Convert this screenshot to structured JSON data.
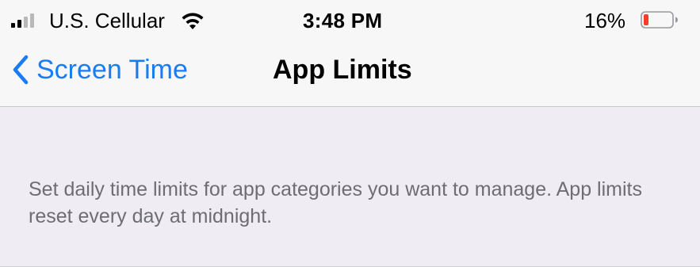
{
  "status_bar": {
    "carrier": "U.S. Cellular",
    "time": "3:48 PM",
    "battery_percent": "16%",
    "battery_level": 0.16,
    "battery_color": "#ff3b30",
    "signal_bars": 2,
    "signal_icon": "cellular-signal-icon",
    "wifi_icon": "wifi-icon",
    "battery_icon": "battery-icon"
  },
  "nav_bar": {
    "back_label": "Screen Time",
    "back_icon": "chevron-left-icon",
    "title": "App Limits",
    "accent_color": "#1a7cf5"
  },
  "content": {
    "description": "Set daily time limits for app categories you want to manage. App limits reset every day at midnight."
  }
}
